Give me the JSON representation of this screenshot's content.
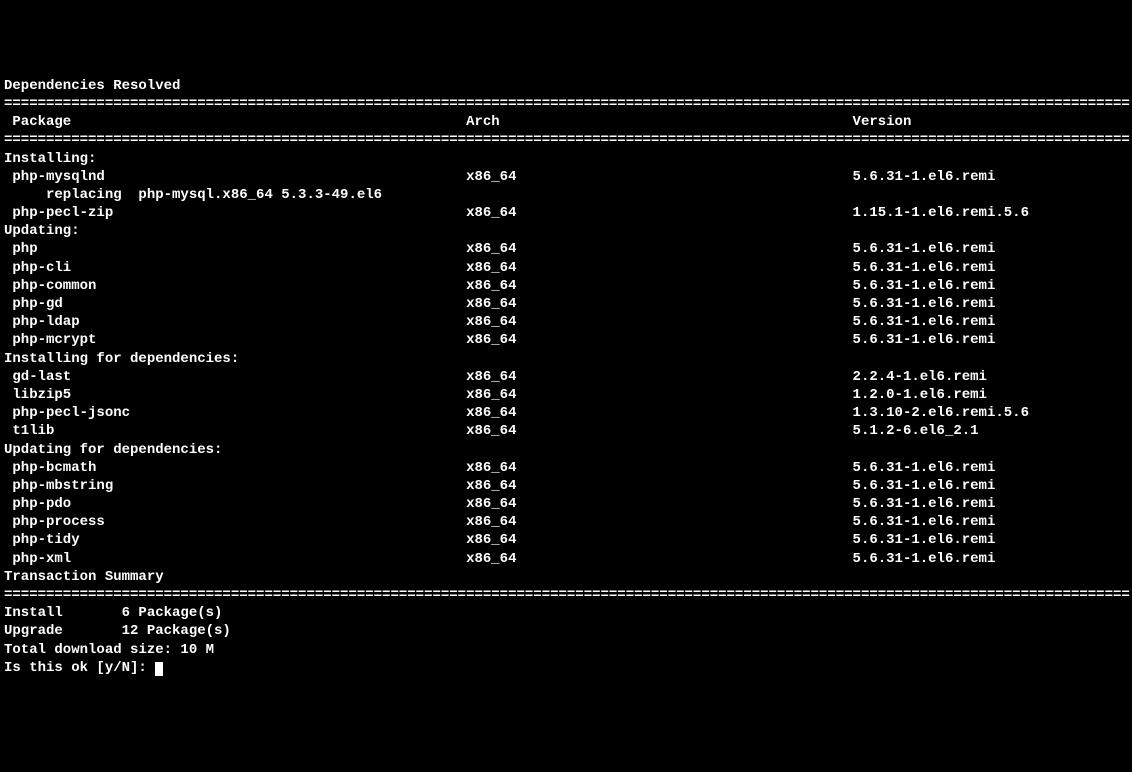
{
  "header": "Dependencies Resolved",
  "columns": {
    "package": "Package",
    "arch": "Arch",
    "version": "Version"
  },
  "sections": [
    {
      "title": "Installing:",
      "rows": [
        {
          "name": "php-mysqlnd",
          "arch": "x86_64",
          "version": "5.6.31-1.el6.remi",
          "replacing": "replacing  php-mysql.x86_64 5.3.3-49.el6"
        },
        {
          "name": "php-pecl-zip",
          "arch": "x86_64",
          "version": "1.15.1-1.el6.remi.5.6"
        }
      ]
    },
    {
      "title": "Updating:",
      "rows": [
        {
          "name": "php",
          "arch": "x86_64",
          "version": "5.6.31-1.el6.remi"
        },
        {
          "name": "php-cli",
          "arch": "x86_64",
          "version": "5.6.31-1.el6.remi"
        },
        {
          "name": "php-common",
          "arch": "x86_64",
          "version": "5.6.31-1.el6.remi"
        },
        {
          "name": "php-gd",
          "arch": "x86_64",
          "version": "5.6.31-1.el6.remi"
        },
        {
          "name": "php-ldap",
          "arch": "x86_64",
          "version": "5.6.31-1.el6.remi"
        },
        {
          "name": "php-mcrypt",
          "arch": "x86_64",
          "version": "5.6.31-1.el6.remi"
        }
      ]
    },
    {
      "title": "Installing for dependencies:",
      "rows": [
        {
          "name": "gd-last",
          "arch": "x86_64",
          "version": "2.2.4-1.el6.remi"
        },
        {
          "name": "libzip5",
          "arch": "x86_64",
          "version": "1.2.0-1.el6.remi"
        },
        {
          "name": "php-pecl-jsonc",
          "arch": "x86_64",
          "version": "1.3.10-2.el6.remi.5.6"
        },
        {
          "name": "t1lib",
          "arch": "x86_64",
          "version": "5.1.2-6.el6_2.1"
        }
      ]
    },
    {
      "title": "Updating for dependencies:",
      "rows": [
        {
          "name": "php-bcmath",
          "arch": "x86_64",
          "version": "5.6.31-1.el6.remi"
        },
        {
          "name": "php-mbstring",
          "arch": "x86_64",
          "version": "5.6.31-1.el6.remi"
        },
        {
          "name": "php-pdo",
          "arch": "x86_64",
          "version": "5.6.31-1.el6.remi"
        },
        {
          "name": "php-process",
          "arch": "x86_64",
          "version": "5.6.31-1.el6.remi"
        },
        {
          "name": "php-tidy",
          "arch": "x86_64",
          "version": "5.6.31-1.el6.remi"
        },
        {
          "name": "php-xml",
          "arch": "x86_64",
          "version": "5.6.31-1.el6.remi"
        }
      ]
    }
  ],
  "summary_title": "Transaction Summary",
  "summary": {
    "install_label": "Install",
    "install_count": "6 Package(s)",
    "upgrade_label": "Upgrade",
    "upgrade_count": "12 Package(s)"
  },
  "download_size": "Total download size: 10 M",
  "prompt": "Is this ok [y/N]: ",
  "layout": {
    "col_arch": 55,
    "col_version": 101,
    "width": 134
  }
}
